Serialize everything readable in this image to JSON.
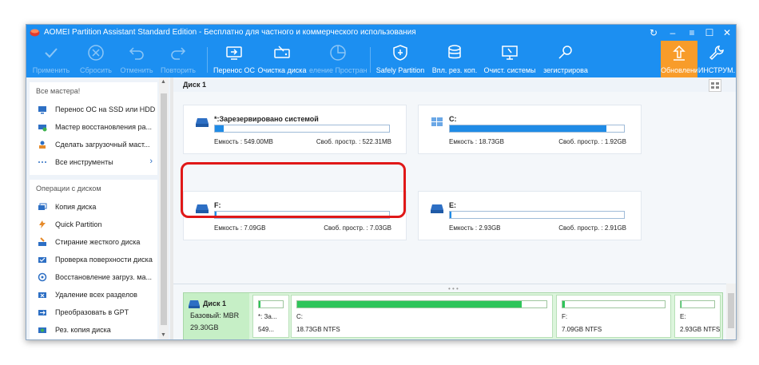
{
  "window": {
    "title": "AOMEI Partition Assistant Standard Edition - Бесплатно для частного и коммерческого использования",
    "controls": [
      "refresh-icon",
      "minimize",
      "menu",
      "maximize",
      "close"
    ]
  },
  "toolbar": {
    "apply": "Применить",
    "discard": "Сбросить",
    "undo": "Отменить",
    "redo": "Повторить",
    "migrate_os": "Перенос ОС",
    "disk_cleanup": "Очистка диска",
    "space_alloc": "еление Простран",
    "safely_partition": "Safely Partition",
    "backup": "Впл. рез. коп.",
    "system_clean": "Очист. системы",
    "register": "зегистрирова",
    "update": "Обновление",
    "tools": "ИНСТРУМ."
  },
  "sidebar": {
    "wizards_title": "Все мастера!",
    "wizards": [
      {
        "label": "Перенос ОС на SSD или HDD",
        "icon": "migrate-icon"
      },
      {
        "label": "Мастер восстановления ра...",
        "icon": "recover-icon"
      },
      {
        "label": "Сделать загрузочный маст...",
        "icon": "bootable-icon"
      },
      {
        "label": "Все инструменты",
        "icon": "dots-icon"
      }
    ],
    "disk_ops_title": "Операции с диском",
    "disk_ops": [
      {
        "label": "Копия диска",
        "icon": "copy-disk-icon"
      },
      {
        "label": "Quick Partition",
        "icon": "quick-partition-icon"
      },
      {
        "label": "Стирание жесткого диска",
        "icon": "wipe-icon"
      },
      {
        "label": "Проверка поверхности диска",
        "icon": "surface-test-icon"
      },
      {
        "label": "Восстановление загруз. ма...",
        "icon": "rebuild-mbr-icon"
      },
      {
        "label": "Удаление всех разделов",
        "icon": "delete-all-icon"
      },
      {
        "label": "Преобразовать в GPT",
        "icon": "convert-gpt-icon"
      },
      {
        "label": "Рез. копия диска",
        "icon": "backup-disk-icon"
      }
    ]
  },
  "main": {
    "disk_title": "Диск 1",
    "partitions": [
      {
        "name": "*:Зарезервировано системой",
        "capacity": "Емкость : 549.00MB",
        "free": "Своб. простр. : 522.31MB",
        "used_fraction": 0.05,
        "icon": "drive-icon"
      },
      {
        "name": "C:",
        "capacity": "Емкость : 18.73GB",
        "free": "Своб. простр. : 1.92GB",
        "used_fraction": 0.9,
        "icon": "windows-icon"
      },
      {
        "name": "F:",
        "capacity": "Емкость : 7.09GB",
        "free": "Своб. простр. : 7.03GB",
        "used_fraction": 0.01,
        "icon": "drive-icon"
      },
      {
        "name": "E:",
        "capacity": "Емкость : 2.93GB",
        "free": "Своб. простр. : 2.91GB",
        "used_fraction": 0.01,
        "icon": "drive-icon"
      }
    ]
  },
  "disk_map": {
    "name": "Диск 1",
    "type": "Базовый: MBR",
    "size": "29.30GB",
    "segments": [
      {
        "name": "*: За...",
        "info": "549...",
        "used_fraction": 0.05
      },
      {
        "name": "C:",
        "info": "18.73GB NTFS",
        "used_fraction": 0.9
      },
      {
        "name": "F:",
        "info": "7.09GB NTFS",
        "used_fraction": 0.02
      },
      {
        "name": "E:",
        "info": "2.93GB NTFS",
        "used_fraction": 0.02
      }
    ]
  },
  "colors": {
    "titlebar": "#1c8ff1",
    "update_button": "#f89c2a",
    "used_bar": "#1f8be6",
    "map_fill": "#2ec55a",
    "highlight": "#e01818"
  }
}
